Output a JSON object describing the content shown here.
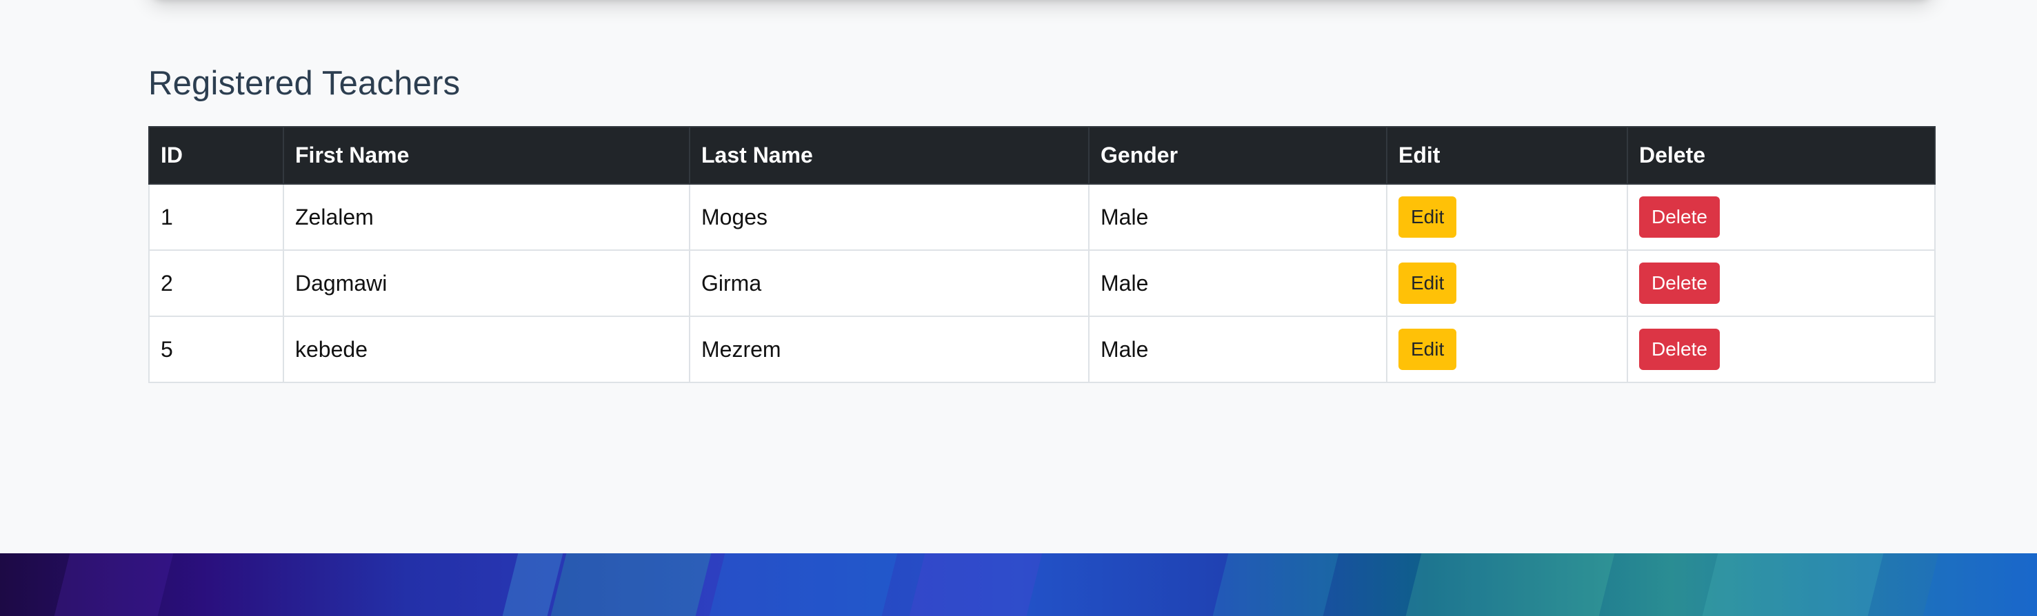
{
  "section": {
    "title": "Registered Teachers"
  },
  "table": {
    "headers": [
      "ID",
      "First Name",
      "Last Name",
      "Gender",
      "Edit",
      "Delete"
    ],
    "rows": [
      {
        "id": "1",
        "first_name": "Zelalem",
        "last_name": "Moges",
        "gender": "Male",
        "edit_label": "Edit",
        "delete_label": "Delete"
      },
      {
        "id": "2",
        "first_name": "Dagmawi",
        "last_name": "Girma",
        "gender": "Male",
        "edit_label": "Edit",
        "delete_label": "Delete"
      },
      {
        "id": "5",
        "first_name": "kebede",
        "last_name": "Mezrem",
        "gender": "Male",
        "edit_label": "Edit",
        "delete_label": "Delete"
      }
    ]
  },
  "colors": {
    "page_background": "#f8f9fa",
    "table_header_background": "#212529",
    "edit_button": "#ffc107",
    "delete_button": "#dc3545",
    "title_text": "#2c3e50"
  }
}
